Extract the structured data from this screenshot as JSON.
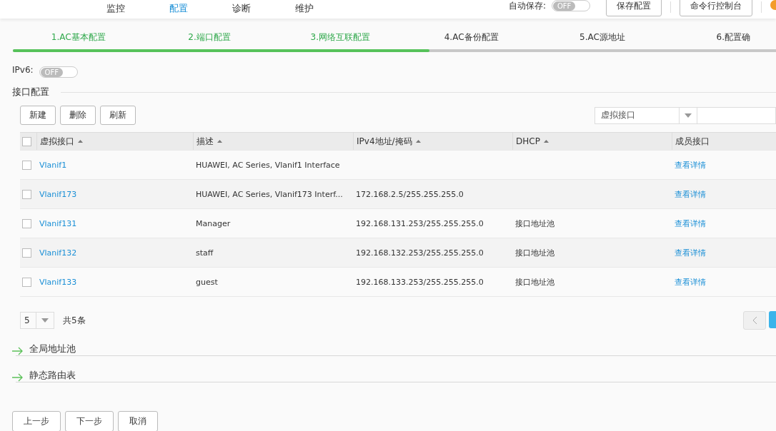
{
  "nav": {
    "tabs": [
      {
        "label": "监控",
        "selected": false
      },
      {
        "label": "配置",
        "selected": true
      },
      {
        "label": "诊断",
        "selected": false
      },
      {
        "label": "维护",
        "selected": false
      }
    ],
    "autosave": {
      "label": "自动保存:",
      "toggle": "OFF",
      "on": false
    },
    "buttons": [
      "保存配置",
      "命令行控制台"
    ]
  },
  "steps": {
    "level": 0.54,
    "items": [
      {
        "label": "1.AC基本配置",
        "done": true
      },
      {
        "label": "2.端口配置",
        "done": true
      },
      {
        "label": "3.网络互联配置",
        "done": true
      },
      {
        "label": "4.AC备份配置",
        "done": false
      },
      {
        "label": "5.AC源地址",
        "done": false
      },
      {
        "label": "6.配置确",
        "done": false
      }
    ]
  },
  "ipv6": {
    "label": "IPv6:",
    "toggle": "OFF",
    "on": false
  },
  "section": {
    "title": "接口配置",
    "toolbar": [
      "新建",
      "删除",
      "刷新"
    ],
    "filter": {
      "value": "虚拟接口"
    },
    "table": {
      "all_checked": false,
      "columns": [
        "虚拟接口",
        "描述",
        "IPv4地址/掩码",
        "DHCP",
        "成员接口"
      ],
      "rows": [
        {
          "checked": false,
          "name": "Vlanif1",
          "desc": "HUAWEI, AC Series, Vlanif1 Interface",
          "ipv4": "",
          "dhcp": "",
          "member": "查看详情"
        },
        {
          "checked": false,
          "name": "Vlanif173",
          "desc": "HUAWEI, AC Series, Vlanif173 Interf...",
          "ipv4": "172.168.2.5/255.255.255.0",
          "dhcp": "",
          "member": "查看详情"
        },
        {
          "checked": false,
          "name": "Vlanif131",
          "desc": "Manager",
          "ipv4": "192.168.131.253/255.255.255.0",
          "dhcp": "接口地址池",
          "member": "查看详情"
        },
        {
          "checked": false,
          "name": "Vlanif132",
          "desc": "staff",
          "ipv4": "192.168.132.253/255.255.255.0",
          "dhcp": "接口地址池",
          "member": "查看详情"
        },
        {
          "checked": false,
          "name": "Vlanif133",
          "desc": "guest",
          "ipv4": "192.168.133.253/255.255.255.0",
          "dhcp": "接口地址池",
          "member": "查看详情"
        }
      ]
    },
    "page_size": "5",
    "total": "共5条"
  },
  "collapsed_sections": [
    "全局地址池",
    "静态路由表"
  ],
  "footer_buttons": [
    "上一步",
    "下一步",
    "取消"
  ]
}
